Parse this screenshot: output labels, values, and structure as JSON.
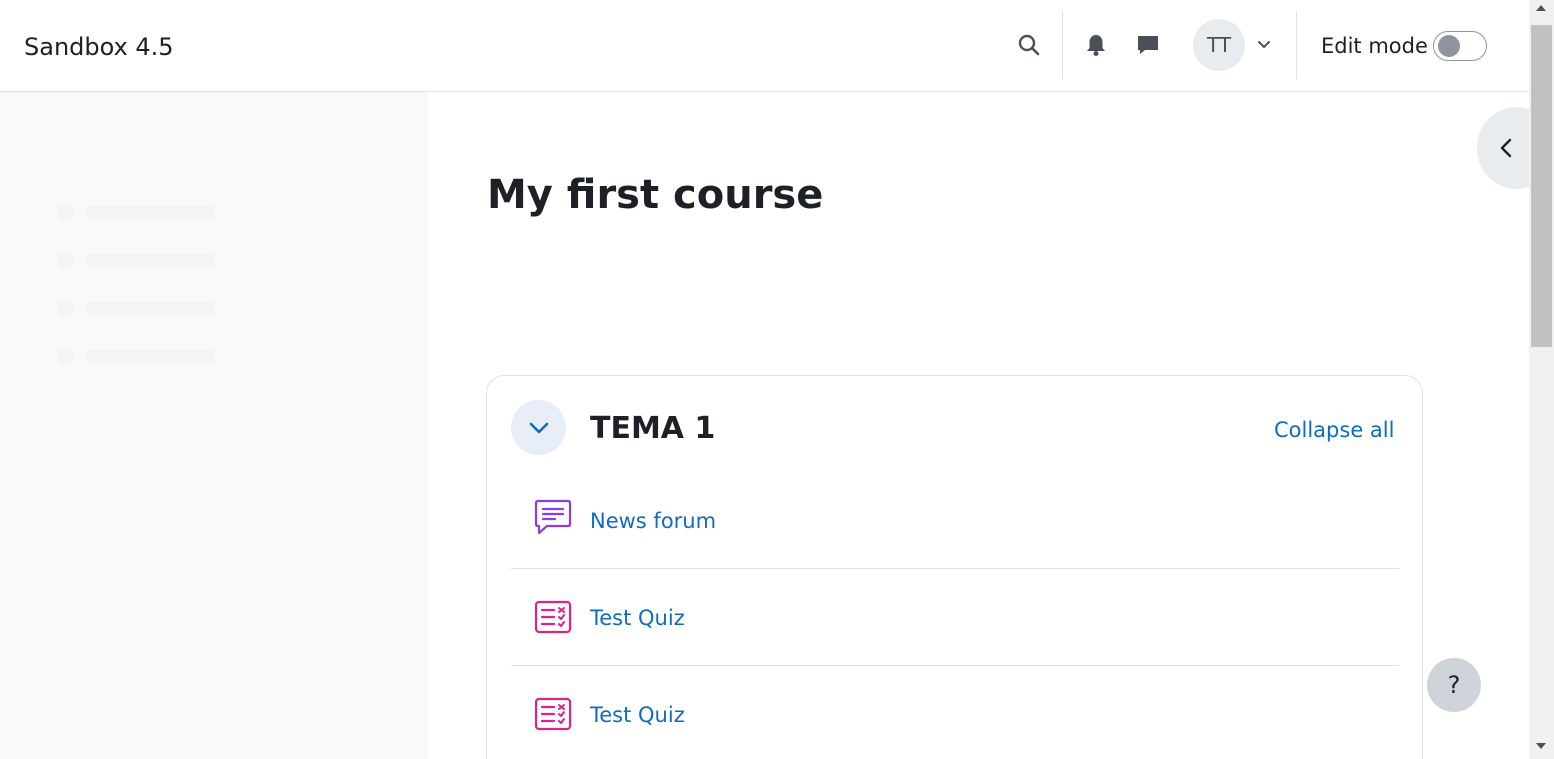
{
  "navbar": {
    "site_name": "Sandbox 4.5",
    "avatar_initials": "TT",
    "edit_mode_label": "Edit mode",
    "edit_mode_on": false,
    "icons": [
      "search-icon",
      "bell-icon",
      "message-icon",
      "chevron-down-icon"
    ]
  },
  "course": {
    "title": "My first course",
    "section": {
      "title": "TEMA 1",
      "collapse_all_label": "Collapse all",
      "activities": [
        {
          "name": "News forum",
          "icon": "forum-icon"
        },
        {
          "name": "Test Quiz",
          "icon": "quiz-icon"
        },
        {
          "name": "Test Quiz",
          "icon": "quiz-icon"
        }
      ]
    }
  },
  "help": {
    "label": "?"
  },
  "colors": {
    "link": "#0f6cbf",
    "forum_icon": "#8d3ddd",
    "quiz_icon": "#e0218a",
    "drawer_bg": "#f8f9fa"
  }
}
